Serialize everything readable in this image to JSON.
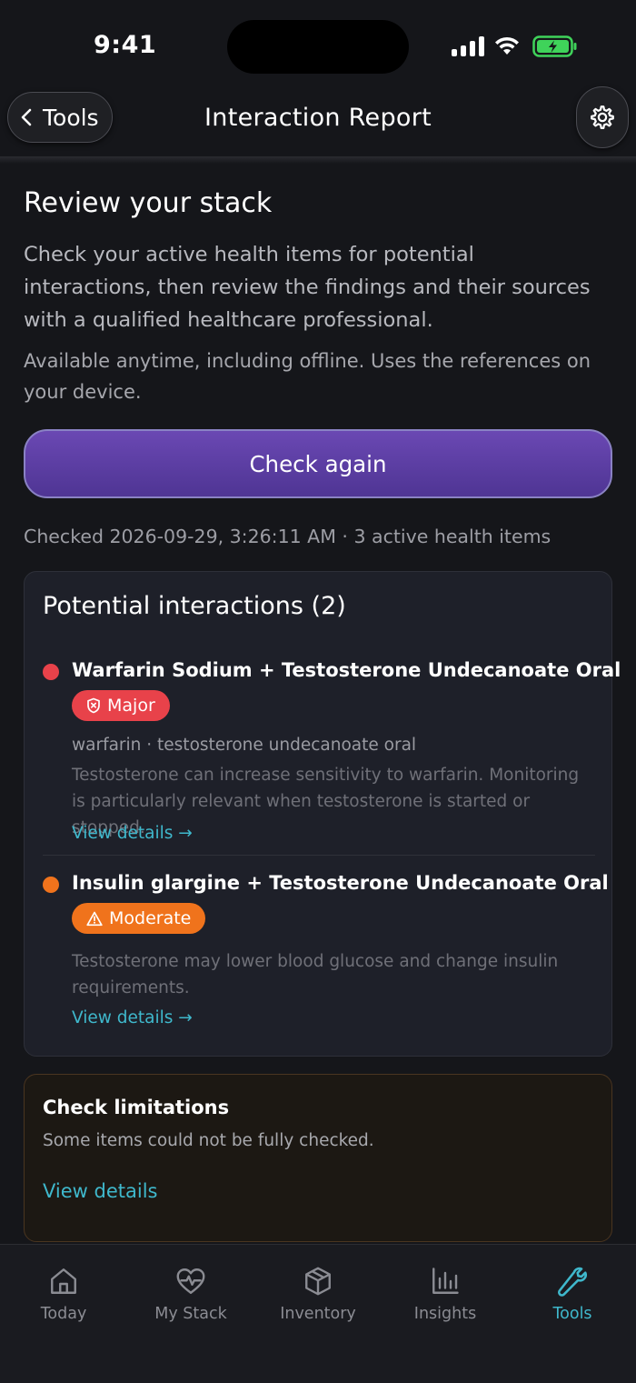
{
  "status_bar": {
    "time": "9:41"
  },
  "header": {
    "back_label": "Tools",
    "title": "Interaction Report"
  },
  "intro": {
    "title": "Review your stack",
    "description": "Check your active health items for potential interactions, then review the findings and their sources with a qualified healthcare professional.",
    "note": "Available anytime, including offline. Uses the references on your device.",
    "check_button": "Check again",
    "checked_line": "Checked 2026-09-29, 3:26:11 AM · 3 active health items"
  },
  "interactions": {
    "title": "Potential interactions (2)",
    "items": [
      {
        "name": "Warfarin Sodium + Testosterone Undecanoate Oral",
        "severity": "Major",
        "severity_color": "#e8424a",
        "drugs": "warfarin · testosterone undecanoate oral",
        "description": "Testosterone can increase sensitivity to warfarin. Monitoring is particularly relevant when testosterone is started or stopped.",
        "link": "View details →"
      },
      {
        "name": "Insulin glargine + Testosterone Undecanoate Oral",
        "severity": "Moderate",
        "severity_color": "#f0731c",
        "description": "Testosterone may lower blood glucose and change insulin requirements.",
        "link": "View details →"
      }
    ]
  },
  "limitations": {
    "title": "Check limitations",
    "description": "Some items could not be fully checked.",
    "link": "View details"
  },
  "tab_bar": {
    "active_color": "#3fb8cc",
    "tabs": [
      {
        "label": "Today",
        "icon": "home-icon"
      },
      {
        "label": "My Stack",
        "icon": "heart-pulse-icon"
      },
      {
        "label": "Inventory",
        "icon": "box-icon"
      },
      {
        "label": "Insights",
        "icon": "bar-chart-icon"
      },
      {
        "label": "Tools",
        "icon": "wrench-icon",
        "active": true
      }
    ]
  }
}
